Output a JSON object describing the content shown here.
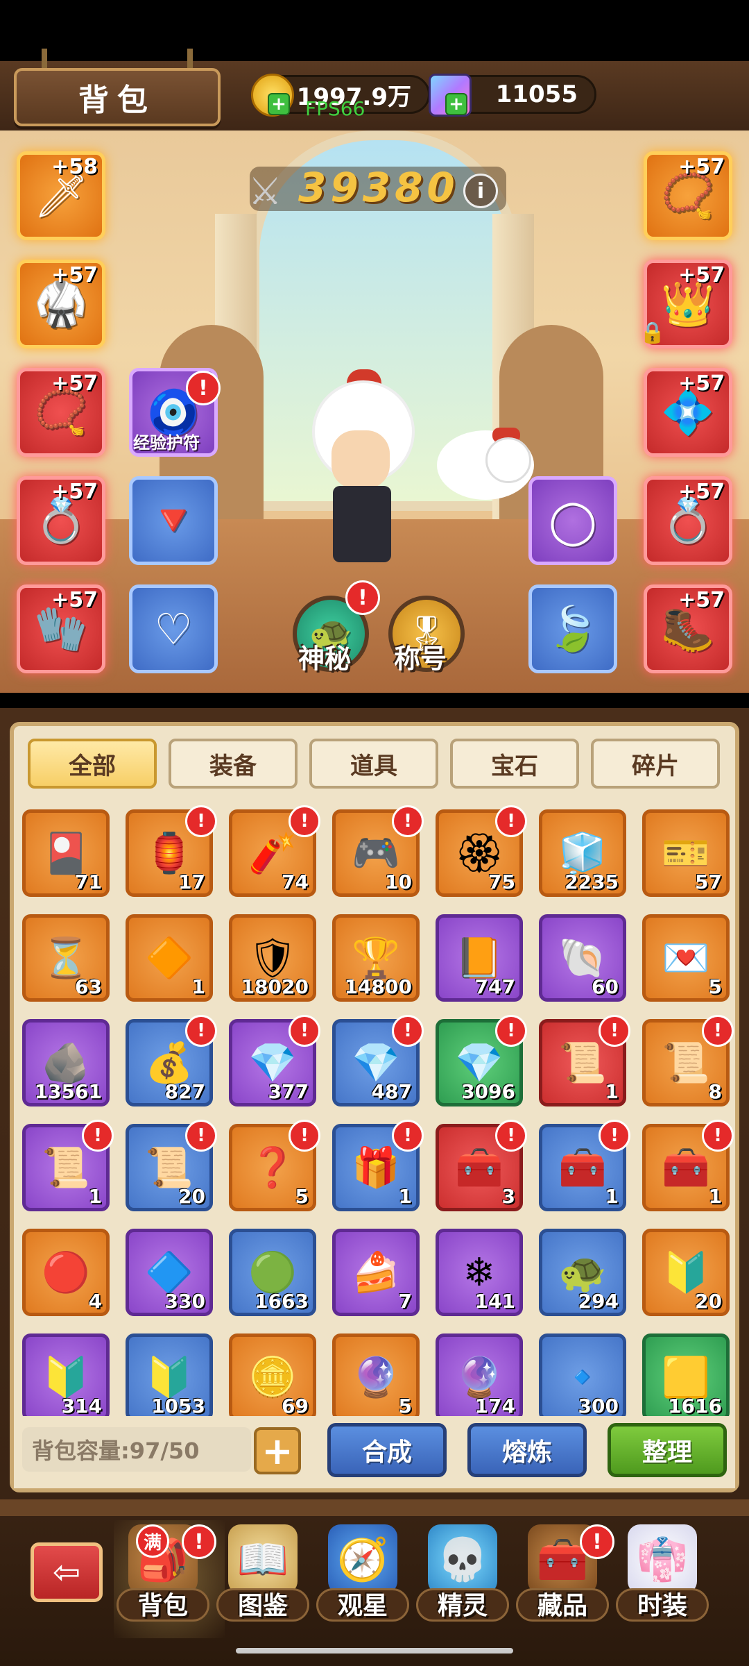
{
  "header": {
    "title": "背包",
    "gold_value": "1997.9万",
    "gem_value": "11055",
    "fps": "FPS66"
  },
  "power": {
    "value": "39380",
    "info_icon": "i"
  },
  "equipment_slots": {
    "left": [
      {
        "level": "+58",
        "icon": "sword-icon",
        "rarity": "orange",
        "glyph": "🗡"
      },
      {
        "level": "+57",
        "icon": "armor-icon",
        "rarity": "orange",
        "glyph": "🥋"
      },
      {
        "level": "+57",
        "icon": "bracelet-icon",
        "rarity": "red",
        "glyph": "💍"
      },
      {
        "level": "+57",
        "icon": "ring-icon",
        "rarity": "red",
        "glyph": "💍"
      },
      {
        "level": "+57",
        "icon": "gauntlet-icon",
        "rarity": "red",
        "glyph": "🧤"
      }
    ],
    "right": [
      {
        "level": "+57",
        "icon": "necklace-icon",
        "rarity": "orange",
        "glyph": "📿"
      },
      {
        "level": "+57",
        "icon": "helmet-icon",
        "rarity": "red",
        "glyph": "👑"
      },
      {
        "level": "+57",
        "icon": "bracer-icon",
        "rarity": "red",
        "glyph": "💠"
      },
      {
        "level": "+57",
        "icon": "ring-icon",
        "rarity": "red",
        "glyph": "💍"
      },
      {
        "level": "+57",
        "icon": "boots-icon",
        "rarity": "red",
        "glyph": "🥾"
      }
    ]
  },
  "accessory_slots": {
    "charm_label": "经验护符",
    "mystery_label": "神秘",
    "title_label": "称号"
  },
  "tabs": [
    "全部",
    "装备",
    "道具",
    "宝石",
    "碎片"
  ],
  "items": [
    {
      "count": "71",
      "color": "orange",
      "icon": "card-icon",
      "glyph": "🎴",
      "alert": false
    },
    {
      "count": "17",
      "color": "orange",
      "icon": "lantern-icon",
      "glyph": "🏮",
      "alert": true
    },
    {
      "count": "74",
      "color": "orange",
      "icon": "firecracker-icon",
      "glyph": "🧨",
      "alert": true
    },
    {
      "count": "10",
      "color": "orange",
      "icon": "gamepad-icon",
      "glyph": "🎮",
      "alert": true
    },
    {
      "count": "75",
      "color": "orange",
      "icon": "medal-icon",
      "glyph": "🏵",
      "alert": true
    },
    {
      "count": "2235",
      "color": "orange",
      "icon": "ice-cube-icon",
      "glyph": "🧊",
      "alert": false
    },
    {
      "count": "57",
      "color": "orange",
      "icon": "ticket-icon",
      "glyph": "🎫",
      "alert": false
    },
    {
      "count": "63",
      "color": "orange",
      "icon": "hourglass-icon",
      "glyph": "⏳",
      "alert": false
    },
    {
      "count": "1",
      "color": "orange",
      "icon": "crest-icon",
      "glyph": "🔶",
      "alert": false
    },
    {
      "count": "18020",
      "color": "orange",
      "icon": "shield-icon",
      "glyph": "🛡",
      "alert": false
    },
    {
      "count": "14800",
      "color": "orange",
      "icon": "trophy-icon",
      "glyph": "🏆",
      "alert": false
    },
    {
      "count": "747",
      "color": "purple",
      "icon": "book-icon",
      "glyph": "📙",
      "alert": false
    },
    {
      "count": "60",
      "color": "purple",
      "icon": "shell-icon",
      "glyph": "🐚",
      "alert": false
    },
    {
      "count": "5",
      "color": "orange",
      "icon": "letter-icon",
      "glyph": "💌",
      "alert": false
    },
    {
      "count": "13561",
      "color": "purple",
      "icon": "ore-icon",
      "glyph": "🪨",
      "alert": false
    },
    {
      "count": "827",
      "color": "blue",
      "icon": "money-bag-icon",
      "glyph": "💰",
      "alert": true
    },
    {
      "count": "377",
      "color": "purple",
      "icon": "gem-icon",
      "glyph": "💎",
      "alert": true
    },
    {
      "count": "487",
      "color": "blue",
      "icon": "gem-icon",
      "glyph": "💎",
      "alert": true
    },
    {
      "count": "3096",
      "color": "green",
      "icon": "gem-icon",
      "glyph": "💎",
      "alert": true
    },
    {
      "count": "1",
      "color": "red",
      "icon": "map-scroll-icon",
      "glyph": "📜",
      "alert": true
    },
    {
      "count": "8",
      "color": "orange",
      "icon": "map-scroll-icon",
      "glyph": "📜",
      "alert": true
    },
    {
      "count": "1",
      "color": "purple",
      "icon": "map-scroll-icon",
      "glyph": "📜",
      "alert": true
    },
    {
      "count": "20",
      "color": "blue",
      "icon": "map-scroll-icon",
      "glyph": "📜",
      "alert": true
    },
    {
      "count": "5",
      "color": "orange",
      "icon": "mystery-chest-icon",
      "glyph": "❓",
      "alert": true
    },
    {
      "count": "1",
      "color": "blue",
      "icon": "gift-box-icon",
      "glyph": "🎁",
      "alert": true
    },
    {
      "count": "3",
      "color": "red",
      "icon": "treasure-chest-icon",
      "glyph": "🧰",
      "alert": true
    },
    {
      "count": "1",
      "color": "blue",
      "icon": "gem-chest-icon",
      "glyph": "🧰",
      "alert": true
    },
    {
      "count": "1",
      "color": "orange",
      "icon": "treasure-chest-icon",
      "glyph": "🧰",
      "alert": true
    },
    {
      "count": "4",
      "color": "orange",
      "icon": "red-orb-icon",
      "glyph": "🔴",
      "alert": false
    },
    {
      "count": "330",
      "color": "purple",
      "icon": "blue-crystal-icon",
      "glyph": "🔷",
      "alert": false
    },
    {
      "count": "1663",
      "color": "blue",
      "icon": "green-crystal-icon",
      "glyph": "🟢",
      "alert": false
    },
    {
      "count": "7",
      "color": "purple",
      "icon": "cake-icon",
      "glyph": "🍰",
      "alert": false
    },
    {
      "count": "141",
      "color": "purple",
      "icon": "snowflake-icon",
      "glyph": "❄",
      "alert": false
    },
    {
      "count": "294",
      "color": "blue",
      "icon": "turtle-icon",
      "glyph": "🐢",
      "alert": false
    },
    {
      "count": "20",
      "color": "orange",
      "icon": "rank-badge-icon",
      "glyph": "🔰",
      "alert": false
    },
    {
      "count": "314",
      "color": "purple",
      "icon": "rank-badge-icon",
      "glyph": "🔰",
      "alert": false
    },
    {
      "count": "1053",
      "color": "blue",
      "icon": "rank-badge-icon",
      "glyph": "🔰",
      "alert": false
    },
    {
      "count": "69",
      "color": "orange",
      "icon": "gold-ore-icon",
      "glyph": "🪙",
      "alert": false
    },
    {
      "count": "5",
      "color": "orange",
      "icon": "crystal-cluster-icon",
      "glyph": "🔮",
      "alert": false
    },
    {
      "count": "174",
      "color": "purple",
      "icon": "crystal-cluster-icon",
      "glyph": "🔮",
      "alert": false
    },
    {
      "count": "300",
      "color": "blue",
      "icon": "crystal-shard-icon",
      "glyph": "🔹",
      "alert": false
    },
    {
      "count": "1616",
      "color": "green",
      "icon": "gold-ingot-icon",
      "glyph": "🟨",
      "alert": false
    }
  ],
  "footer": {
    "capacity": "背包容量:97/50",
    "expand": "+",
    "compose": "合成",
    "smelt": "熔炼",
    "arrange": "整理"
  },
  "nav": {
    "items": [
      "背包",
      "图鉴",
      "观星",
      "精灵",
      "藏品",
      "时装"
    ],
    "full_badge": "满",
    "exit_icon": "⇦"
  },
  "alert_mark": "!"
}
